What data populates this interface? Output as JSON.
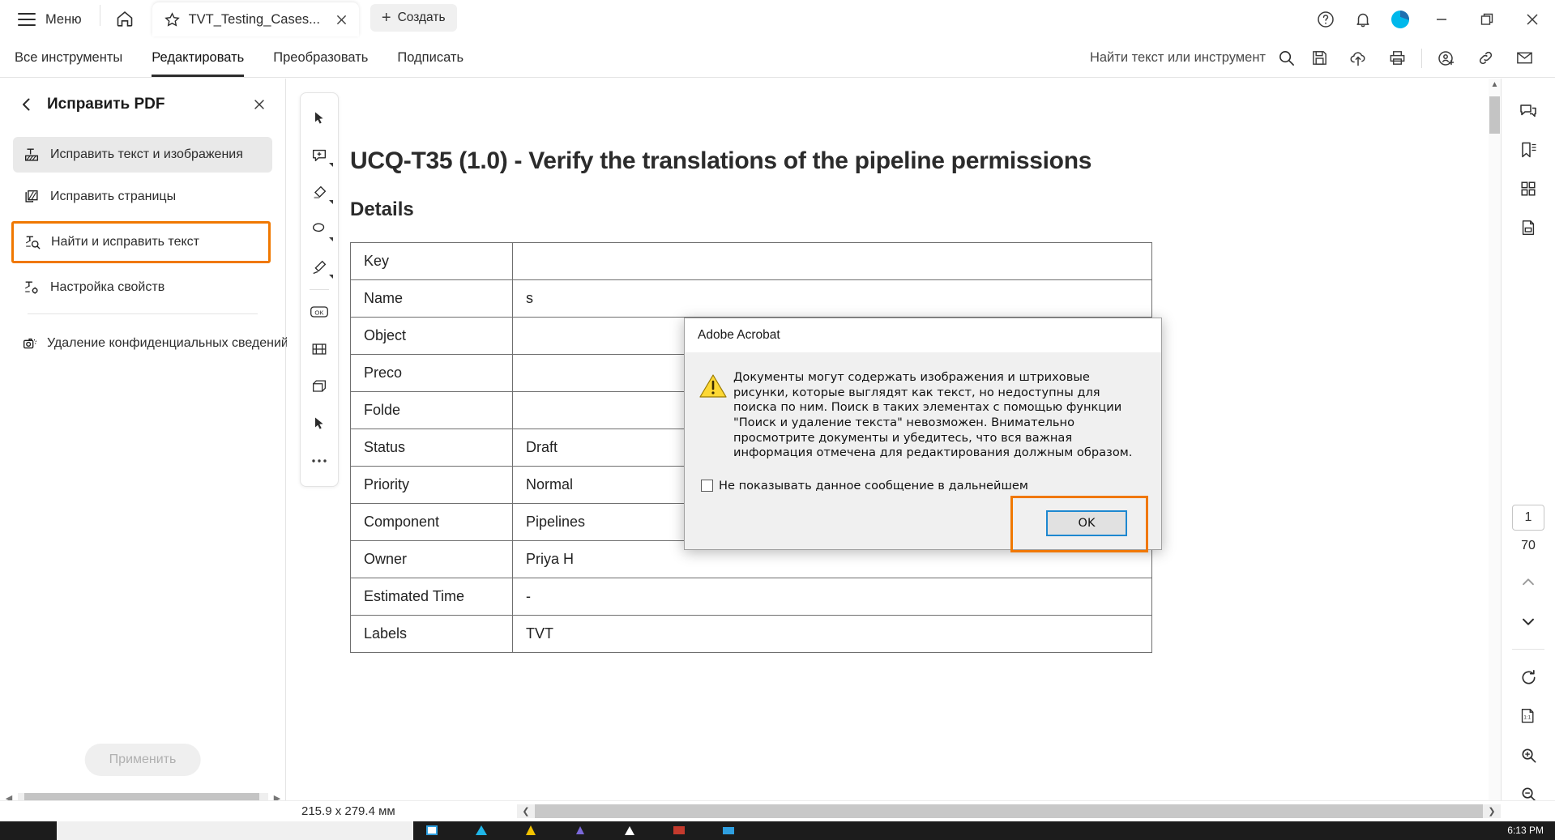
{
  "window": {
    "menu_label": "Меню",
    "tab_title": "TVT_Testing_Cases...",
    "new_tab_label": "Создать"
  },
  "menubar": {
    "items": [
      {
        "label": "Все инструменты",
        "active": false
      },
      {
        "label": "Редактировать",
        "active": true
      },
      {
        "label": "Преобразовать",
        "active": false
      },
      {
        "label": "Подписать",
        "active": false
      }
    ],
    "search_placeholder": "Найти текст или инструмент"
  },
  "left_panel": {
    "title": "Исправить PDF",
    "items": [
      {
        "label": "Исправить текст и изображения",
        "icon": "edit-text-image-icon",
        "state": "selected"
      },
      {
        "label": "Исправить страницы",
        "icon": "edit-pages-icon",
        "state": "normal"
      },
      {
        "label": "Найти и исправить текст",
        "icon": "find-replace-text-icon",
        "state": "highlighted"
      },
      {
        "label": "Настройка свойств",
        "icon": "properties-icon",
        "state": "normal"
      }
    ],
    "extra_items": [
      {
        "label": "Удаление конфиденциальных сведений",
        "icon": "redact-icon"
      }
    ],
    "apply_button": "Применить"
  },
  "document": {
    "title": "UCQ-T35 (1.0) - Verify the translations of the pipeline permissions",
    "heading": "Details",
    "rows": [
      {
        "key": "Key",
        "value": ""
      },
      {
        "key": "Name",
        "value": "s"
      },
      {
        "key": "Object",
        "value": ""
      },
      {
        "key": "Preco",
        "value": ""
      },
      {
        "key": "Folde",
        "value": ""
      },
      {
        "key": "Status",
        "value": "Draft"
      },
      {
        "key": "Priority",
        "value": "Normal"
      },
      {
        "key": "Component",
        "value": "Pipelines"
      },
      {
        "key": "Owner",
        "value": "Priya H"
      },
      {
        "key": "Estimated Time",
        "value": "-"
      },
      {
        "key": "Labels",
        "value": "TVT"
      }
    ]
  },
  "dialog": {
    "title": "Adobe Acrobat",
    "message": "Документы могут содержать изображения и штриховые рисунки, которые выглядят как текст, но недоступны для поиска по ним. Поиск в таких элементах с помощью функции \"Поиск и удаление текста\" невозможен. Внимательно просмотрите документы и убедитесь, что вся важная информация отмечена для редактирования должным образом.",
    "checkbox_label": "Не показывать данное сообщение в дальнейшем",
    "ok_label": "OK"
  },
  "right_rail": {
    "page_current": "1",
    "page_total": "70"
  },
  "status": {
    "page_dimensions": "215.9 x 279.4 мм"
  },
  "taskbar": {
    "clock": "6:13 PM"
  },
  "colors": {
    "accent_orange": "#f07800",
    "avatar_cyan": "#00b8eb",
    "dialog_bg": "#f0f0f0",
    "ok_border_blue": "#1e88d0"
  }
}
